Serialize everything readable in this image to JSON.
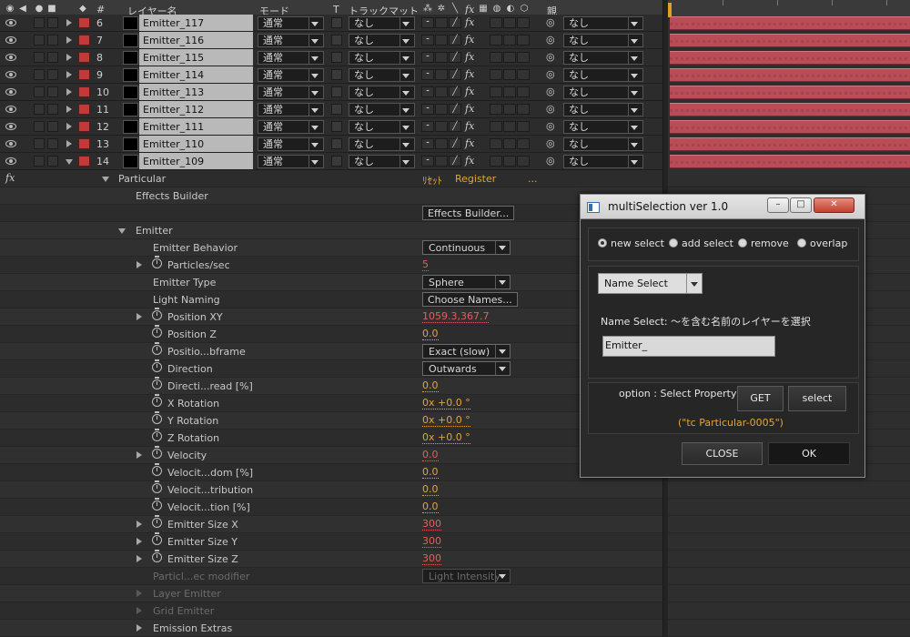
{
  "header": {
    "num": "#",
    "layer_name": "レイヤー名",
    "mode": "モード",
    "t": "T",
    "track_matte": "トラックマット",
    "switch_fx": "fx",
    "parent": "親"
  },
  "layers": [
    {
      "num": "6",
      "name": "Emitter_117",
      "mode": "通常",
      "matte": "なし",
      "parent": "なし",
      "expanded": false
    },
    {
      "num": "7",
      "name": "Emitter_116",
      "mode": "通常",
      "matte": "なし",
      "parent": "なし",
      "expanded": false
    },
    {
      "num": "8",
      "name": "Emitter_115",
      "mode": "通常",
      "matte": "なし",
      "parent": "なし",
      "expanded": false
    },
    {
      "num": "9",
      "name": "Emitter_114",
      "mode": "通常",
      "matte": "なし",
      "parent": "なし",
      "expanded": false
    },
    {
      "num": "10",
      "name": "Emitter_113",
      "mode": "通常",
      "matte": "なし",
      "parent": "なし",
      "expanded": false
    },
    {
      "num": "11",
      "name": "Emitter_112",
      "mode": "通常",
      "matte": "なし",
      "parent": "なし",
      "expanded": false
    },
    {
      "num": "12",
      "name": "Emitter_111",
      "mode": "通常",
      "matte": "なし",
      "parent": "なし",
      "expanded": false
    },
    {
      "num": "13",
      "name": "Emitter_110",
      "mode": "通常",
      "matte": "なし",
      "parent": "なし",
      "expanded": false
    },
    {
      "num": "14",
      "name": "Emitter_109",
      "mode": "通常",
      "matte": "なし",
      "parent": "なし",
      "expanded": true
    }
  ],
  "effect": {
    "fx_label": "fx",
    "name": "Particular",
    "reset": "ﾘｾｯﾄ",
    "register": "Register",
    "more": "...",
    "effects_builder_label": "Effects Builder",
    "effects_builder_button": "Effects Builder...",
    "emitter": "Emitter"
  },
  "properties": [
    {
      "name": "Emitter Behavior",
      "control": "dropdown",
      "value": "Continuous",
      "indent": 1
    },
    {
      "name": "Particles/sec",
      "control": "value",
      "value": "5",
      "color": "red",
      "twist": true,
      "stopwatch": true,
      "indent": 1
    },
    {
      "name": "Emitter Type",
      "control": "dropdown",
      "value": "Sphere",
      "indent": 1
    },
    {
      "name": "Light Naming",
      "control": "button",
      "value": "Choose Names...",
      "indent": 1
    },
    {
      "name": "Position XY",
      "control": "value",
      "value": "1059.3,367.7",
      "color": "red",
      "twist": true,
      "stopwatch": true,
      "indent": 1
    },
    {
      "name": "Position Z",
      "control": "value",
      "value": "0.0",
      "color": "orange",
      "stopwatch": true,
      "indent": 1
    },
    {
      "name": "Positio...bframe",
      "control": "dropdown",
      "value": "Exact (slow)",
      "stopwatch": true,
      "indent": 1
    },
    {
      "name": "Direction",
      "control": "dropdown",
      "value": "Outwards",
      "stopwatch": true,
      "indent": 1
    },
    {
      "name": "Directi...read [%]",
      "control": "value",
      "value": "0.0",
      "color": "orange",
      "stopwatch": true,
      "indent": 1
    },
    {
      "name": "X Rotation",
      "control": "value",
      "value": "0x +0.0 °",
      "color": "orange",
      "stopwatch": true,
      "indent": 1
    },
    {
      "name": "Y Rotation",
      "control": "value",
      "value": "0x +0.0 °",
      "color": "orange",
      "stopwatch": true,
      "indent": 1
    },
    {
      "name": "Z Rotation",
      "control": "value",
      "value": "0x +0.0 °",
      "color": "orange",
      "stopwatch": true,
      "indent": 1
    },
    {
      "name": "Velocity",
      "control": "value",
      "value": "0.0",
      "color": "red",
      "twist": true,
      "stopwatch": true,
      "indent": 1
    },
    {
      "name": "Velocit...dom [%]",
      "control": "value",
      "value": "0.0",
      "color": "orange",
      "stopwatch": true,
      "indent": 1
    },
    {
      "name": "Velocit...tribution",
      "control": "value",
      "value": "0.0",
      "color": "orange",
      "stopwatch": true,
      "indent": 1
    },
    {
      "name": "Velocit...tion [%]",
      "control": "value",
      "value": "0.0",
      "color": "orange",
      "stopwatch": true,
      "indent": 1
    },
    {
      "name": "Emitter Size X",
      "control": "value",
      "value": "300",
      "color": "red",
      "twist": true,
      "stopwatch": true,
      "indent": 1
    },
    {
      "name": "Emitter Size Y",
      "control": "value",
      "value": "300",
      "color": "red",
      "twist": true,
      "stopwatch": true,
      "indent": 1
    },
    {
      "name": "Emitter Size Z",
      "control": "value",
      "value": "300",
      "color": "red",
      "twist": true,
      "stopwatch": true,
      "indent": 1
    },
    {
      "name": "Particl...ec modifier",
      "control": "dropdown-disabled",
      "value": "Light Intensity",
      "dim": true,
      "indent": 1
    },
    {
      "name": "Layer Emitter",
      "control": "none",
      "twist": true,
      "dim": true,
      "indent": 1
    },
    {
      "name": "Grid Emitter",
      "control": "none",
      "twist": true,
      "dim": true,
      "indent": 1
    },
    {
      "name": "Emission Extras",
      "control": "none",
      "twist": true,
      "indent": 1
    }
  ],
  "dialog": {
    "title": "multiSelection ver 1.0",
    "window_buttons": {
      "minimize": "–",
      "maximize": "□",
      "close": "✕"
    },
    "modes": [
      {
        "label": "new select",
        "selected": true
      },
      {
        "label": "add select",
        "selected": false
      },
      {
        "label": "remove",
        "selected": false
      },
      {
        "label": "overlap",
        "selected": false
      }
    ],
    "select_type": "Name Select",
    "description": "Name Select: ～を含む名前のレイヤーを選択",
    "name_input": "Emitter_",
    "option_label": "option : Select Property",
    "get_button": "GET",
    "select_button": "select",
    "property_result": "(\"tc Particular-0005\")",
    "close_button": "CLOSE",
    "ok_button": "OK"
  },
  "colors": {
    "label_red": "#c23939",
    "value_orange": "#e2a53a",
    "value_red": "#e0605a",
    "layer_bar": "#b84d57",
    "current_time": "#e0a020"
  }
}
